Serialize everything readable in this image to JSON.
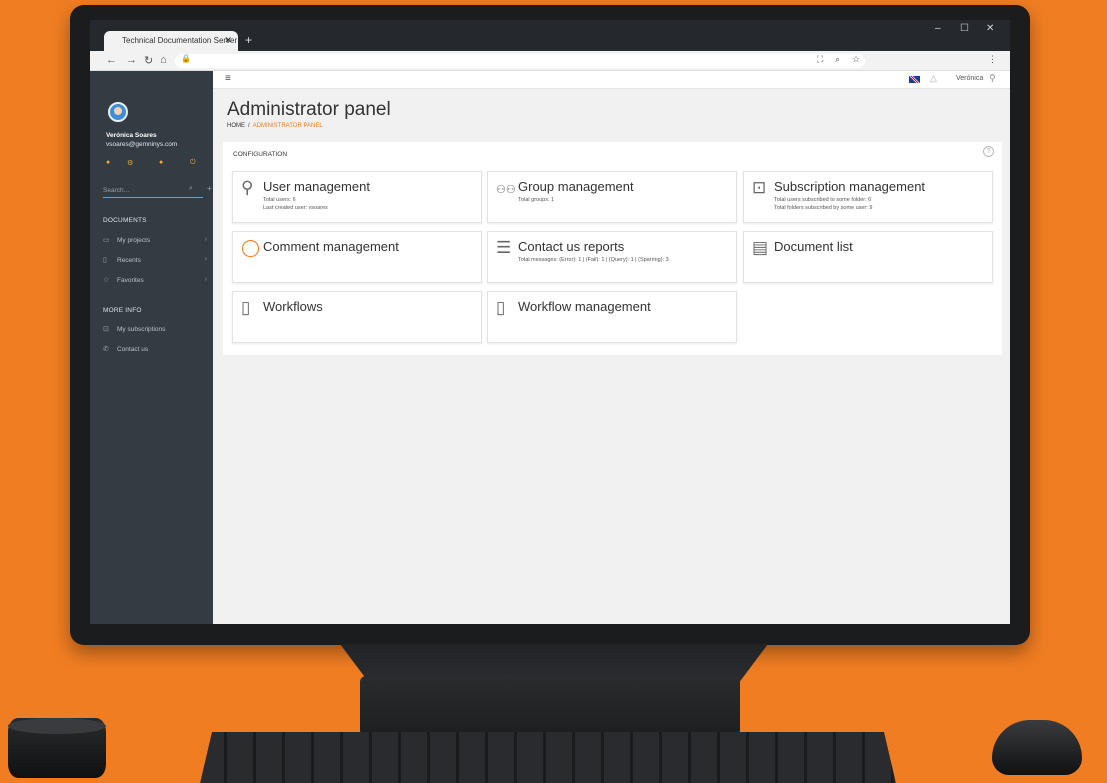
{
  "browser": {
    "tab_title": "Technical Documentation Server",
    "tab_close": "✕",
    "new_tab": "+",
    "window_controls": [
      "–",
      "☐",
      "✕"
    ]
  },
  "sidebar": {
    "user_name": "Verónica Soares",
    "user_email": "vsoares@gemninys.com",
    "search_placeholder": "Search...",
    "documents_title": "DOCUMENTS",
    "documents_items": [
      {
        "label": "My projects",
        "icon": "folder-icon"
      },
      {
        "label": "Recents",
        "icon": "clock-icon"
      },
      {
        "label": "Favorites",
        "icon": "star-icon"
      }
    ],
    "moreinfo_title": "MORE INFO",
    "moreinfo_items": [
      {
        "label": "My subscriptions",
        "icon": "rss-icon"
      },
      {
        "label": "Contact us",
        "icon": "phone-icon"
      }
    ]
  },
  "topbar": {
    "user": "Verónica"
  },
  "page": {
    "title": "Administrator panel",
    "breadcrumb_home": "HOME",
    "breadcrumb_sep": "/",
    "breadcrumb_current": "ADMINISTRATOR PANEL",
    "section_title": "CONFIGURATION",
    "help": "?"
  },
  "cards": {
    "user_management": {
      "title": "User management",
      "lines": [
        "Total users: 6",
        "Last created user: vsoares"
      ]
    },
    "group_management": {
      "title": "Group management",
      "lines": [
        "Total groups: 1"
      ]
    },
    "subscription_management": {
      "title": "Subscription management",
      "lines": [
        "Total users subscribed to some folder: 6",
        "Total folders subscribed by some user: 9"
      ]
    },
    "comment_management": {
      "title": "Comment management",
      "lines": []
    },
    "contact_us_reports": {
      "title": "Contact us reports",
      "lines": [
        "Total messages: (Error): 1 | (Fail): 1 | (Query): 1 | (Sparring): 3"
      ]
    },
    "document_list": {
      "title": "Document list",
      "lines": []
    },
    "workflows": {
      "title": "Workflows",
      "lines": []
    },
    "workflow_management": {
      "title": "Workflow management",
      "lines": []
    }
  },
  "colors": {
    "accent": "#f07d22",
    "sidebar_bg": "#333b43",
    "background": "#f07d22"
  }
}
